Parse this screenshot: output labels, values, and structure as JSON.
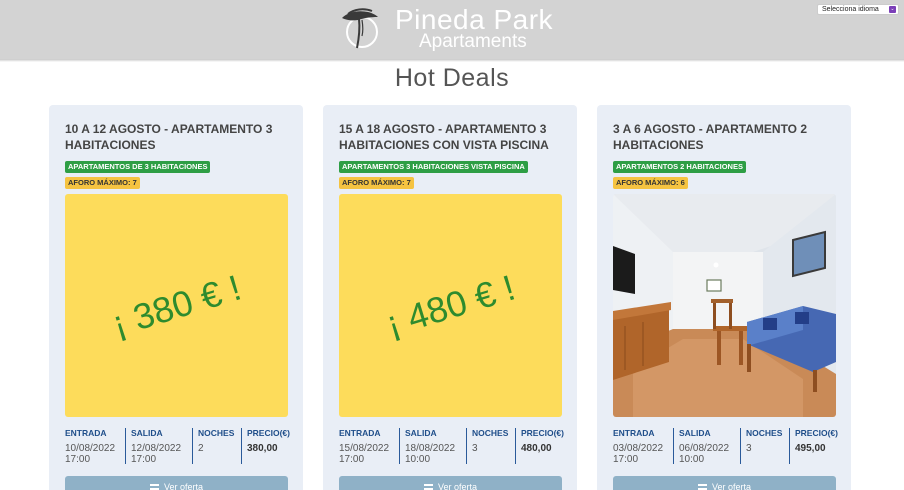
{
  "header": {
    "logo_line1": "Pineda Park",
    "logo_line2": "Apartaments",
    "language_selector": "Selecciona idioma"
  },
  "page_title": "Hot Deals",
  "labels": {
    "entrada": "ENTRADA",
    "salida": "SALIDA",
    "noches": "NOCHES",
    "precio": "PRECIO(€)",
    "button": "Ver oferta"
  },
  "cards": [
    {
      "title": "10 A 12 AGOSTO - APARTAMENTO 3 HABITACIONES",
      "category": "APARTAMENTOS DE 3 HABITACIONES",
      "capacity": "AFORO MÁXIMO: 7",
      "deal_text": "¡ 380 € !",
      "entrada_date": "10/08/2022",
      "entrada_time": "17:00",
      "salida_date": "12/08/2022",
      "salida_time": "17:00",
      "noches": "2",
      "precio": "380,00"
    },
    {
      "title": "15 A 18 AGOSTO - APARTAMENTO 3 HABITACIONES CON VISTA PISCINA",
      "category": "APARTAMENTOS 3 HABITACIONES VISTA PISCINA",
      "capacity": "AFORO MÁXIMO: 7",
      "deal_text": "¡ 480 € !",
      "entrada_date": "15/08/2022",
      "entrada_time": "17:00",
      "salida_date": "18/08/2022",
      "salida_time": "10:00",
      "noches": "3",
      "precio": "480,00"
    },
    {
      "title": "3 A 6 AGOSTO - APARTAMENTO 2 HABITACIONES",
      "category": "APARTAMENTOS 2 HABITACIONES",
      "capacity": "AFORO MÁXIMO: 6",
      "entrada_date": "03/08/2022",
      "entrada_time": "17:00",
      "salida_date": "06/08/2022",
      "salida_time": "10:00",
      "noches": "3",
      "precio": "495,00"
    }
  ]
}
